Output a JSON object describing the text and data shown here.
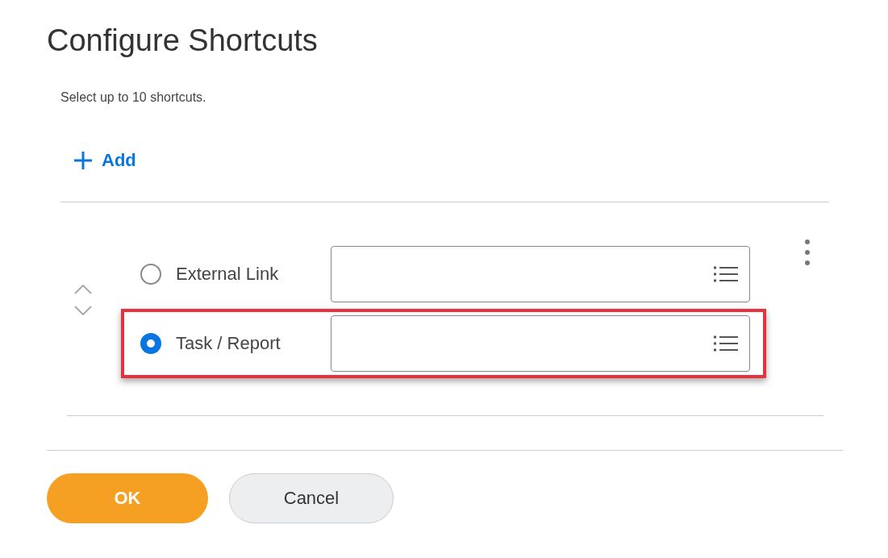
{
  "title": "Configure Shortcuts",
  "instructions": "Select up to 10 shortcuts.",
  "add_button": {
    "label": "Add"
  },
  "options": [
    {
      "label": "External Link",
      "selected": false,
      "highlighted": false
    },
    {
      "label": "Task / Report",
      "selected": true,
      "highlighted": true
    }
  ],
  "buttons": [
    {
      "label": "OK",
      "kind": "primary"
    },
    {
      "label": "Cancel",
      "kind": "secondary"
    }
  ]
}
